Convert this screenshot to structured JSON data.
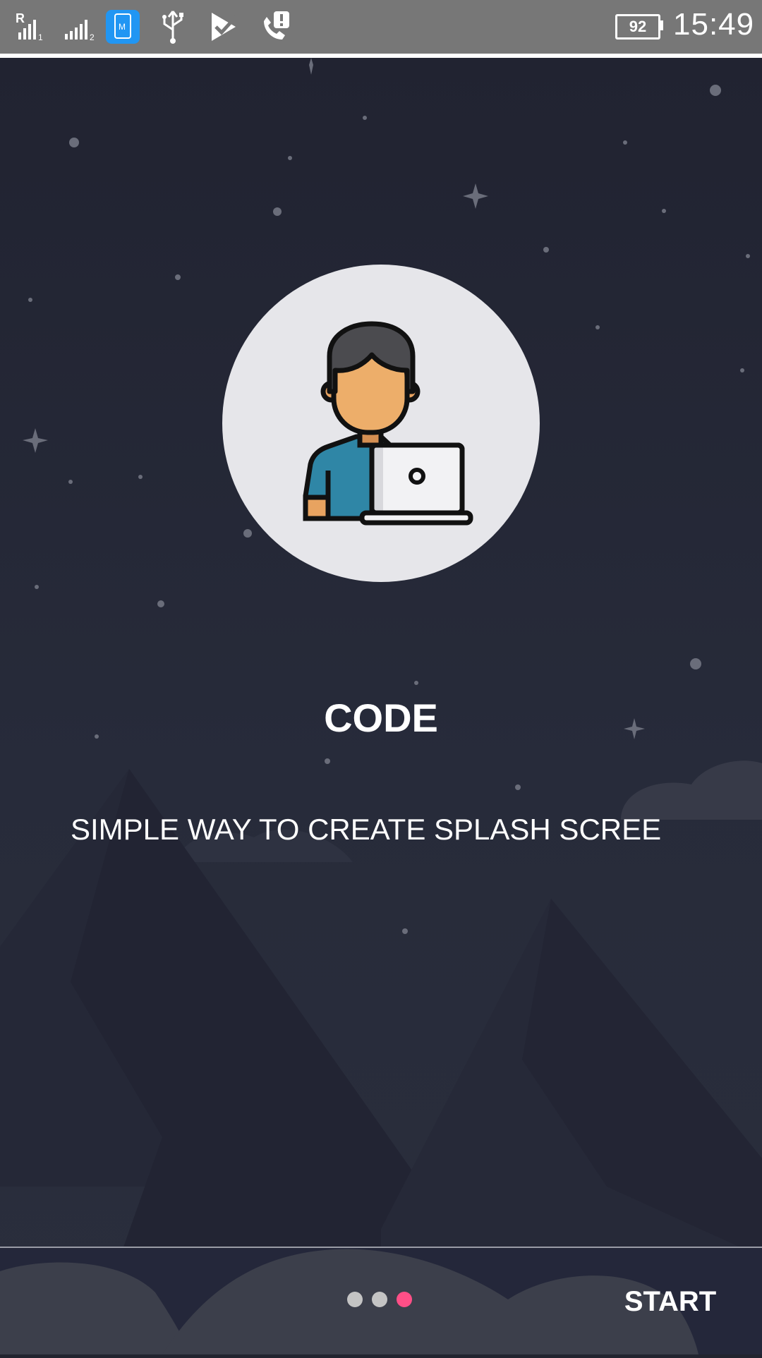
{
  "status_bar": {
    "sim1_indicator": "R",
    "battery_level": "92",
    "time": "15:49"
  },
  "slide": {
    "title": "CODE",
    "subtitle": "SIMPLE WAY TO CREATE SPLASH SCREE",
    "illustration": "developer-with-laptop"
  },
  "pager": {
    "page_count": 3,
    "current_page": 3,
    "inactive_color": "#c4c4c4",
    "active_color": "#ff4f87"
  },
  "footer": {
    "start_label": "START"
  },
  "colors": {
    "background": "#22242f",
    "circle": "#e6e6ea",
    "status_bar": "#777777"
  }
}
